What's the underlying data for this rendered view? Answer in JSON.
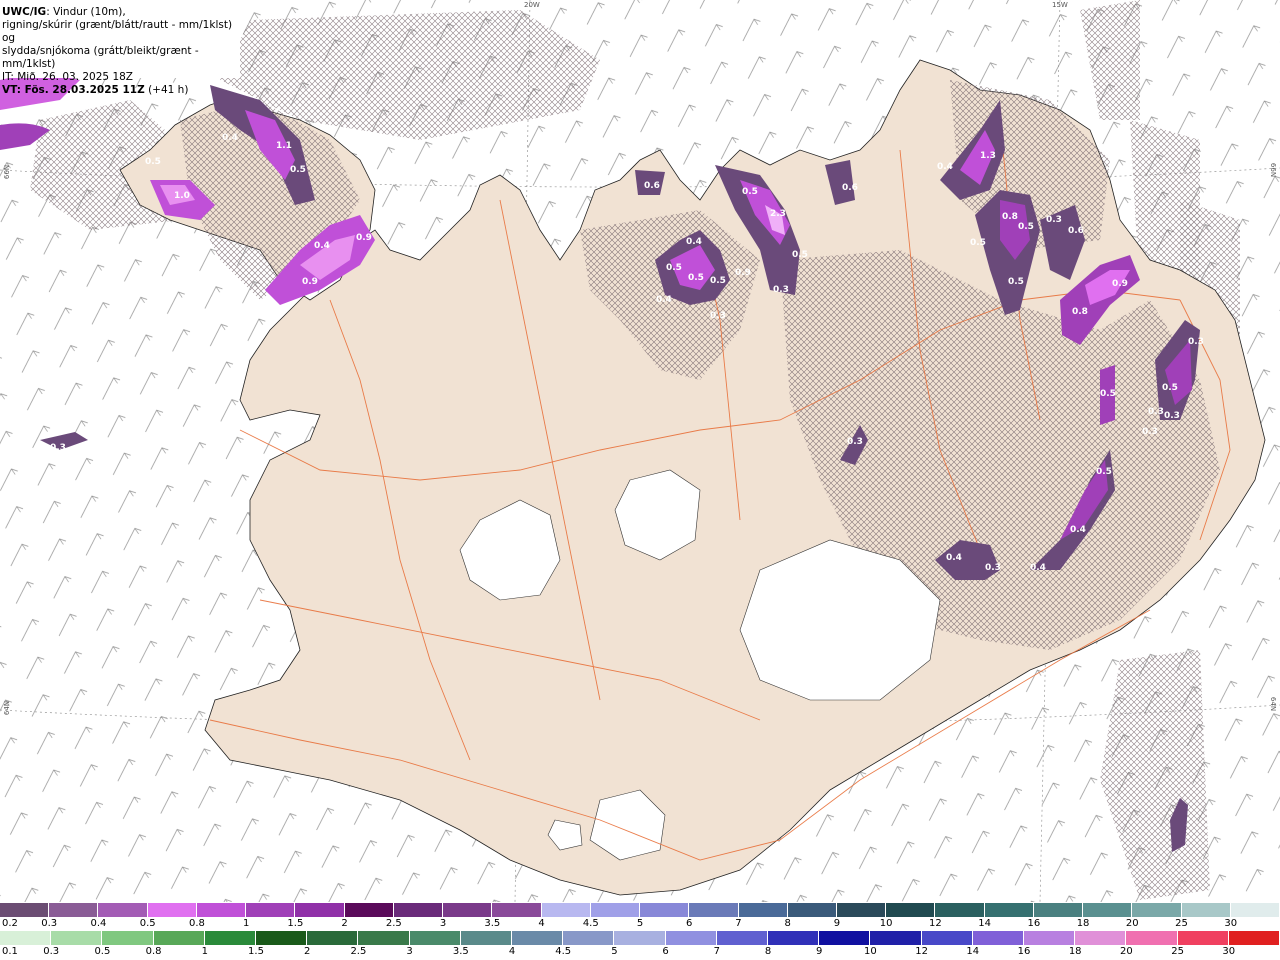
{
  "header": {
    "model": "UWC/IG",
    "line1": ": Vindur (10m),",
    "line2": "rigning/skúrir (grænt/blátt/rautt - mm/1klst) og",
    "line3": "slydda/snjókoma (grátt/bleikt/grænt - mm/1klst)",
    "init_time": "IT: Mið. 26. 03. 2025 18Z",
    "valid_label": "VT: Fös. 28.03.2025 11Z",
    "lead": " (+41 h)"
  },
  "grid_labels": {
    "lon_20w": "20W",
    "lon_15w": "15W",
    "lat_66n_left": "66N",
    "lat_66n_right": "66N",
    "lat_64n_left": "64N",
    "lat_64n_right": "64N"
  },
  "precip_labels": [
    "0.4",
    "1.1",
    "0.5",
    "0.5",
    "1.0",
    "0.4",
    "0.9",
    "0.9",
    "0.6",
    "0.5",
    "0.4",
    "0.5",
    "0.5",
    "0.3",
    "0.4",
    "0.9",
    "0.5",
    "2.3",
    "0.5",
    "0.3",
    "0.6",
    "0.4",
    "1.3",
    "0.8",
    "0.5",
    "0.3",
    "0.6",
    "0.5",
    "0.5",
    "0.9",
    "0.8",
    "0.3",
    "0.5",
    "0.5",
    "0.3",
    "0.3",
    "0.3",
    "0.5",
    "0.4",
    "0.4",
    "0.3",
    "0.4",
    "0.3",
    "0.3"
  ],
  "legend_snow": {
    "labels": [
      "0.2",
      "0.3",
      "0.4",
      "0.5",
      "0.8",
      "1",
      "1.5",
      "2",
      "2.5",
      "3",
      "3.5",
      "4",
      "4.5",
      "5",
      "6",
      "7",
      "8",
      "9",
      "10",
      "12",
      "14",
      "16",
      "18",
      "20",
      "25",
      "30"
    ],
    "colors": [
      "#6b4d73",
      "#8a5c96",
      "#a35cb5",
      "#e070f0",
      "#c050d8",
      "#a040b8",
      "#9030a8",
      "#5a0a5a",
      "#6a2a7a",
      "#7a3a8a",
      "#8a4a9a",
      "#b8b8f0",
      "#a0a0e8",
      "#8888d8",
      "#6a7ab8",
      "#4a6a98",
      "#3a5a7a",
      "#2a4a5a",
      "#204a50",
      "#2a6060",
      "#357070",
      "#4a8080",
      "#5a9090",
      "#7aa8a8",
      "#a8c8c8",
      "#e0ecec"
    ]
  },
  "legend_rain": {
    "labels": [
      "0.1",
      "0.3",
      "0.5",
      "0.8",
      "1",
      "1.5",
      "2",
      "2.5",
      "3",
      "3.5",
      "4",
      "4.5",
      "5",
      "6",
      "7",
      "8",
      "9",
      "10",
      "12",
      "14",
      "16",
      "18",
      "20",
      "25",
      "30"
    ],
    "colors": [
      "#d8f0d8",
      "#a8dca8",
      "#80c880",
      "#58a858",
      "#2a8a3a",
      "#1a5a1a",
      "#2a6a3a",
      "#3a7a4a",
      "#4a8a6a",
      "#5a8a8a",
      "#6a8aa8",
      "#8898c8",
      "#a8b0e0",
      "#9090e0",
      "#6060d0",
      "#3030b8",
      "#1010a0",
      "#2020a8",
      "#4848c8",
      "#8060d8",
      "#b880e0",
      "#e090d8",
      "#f070b0",
      "#f04060",
      "#e02020"
    ]
  }
}
